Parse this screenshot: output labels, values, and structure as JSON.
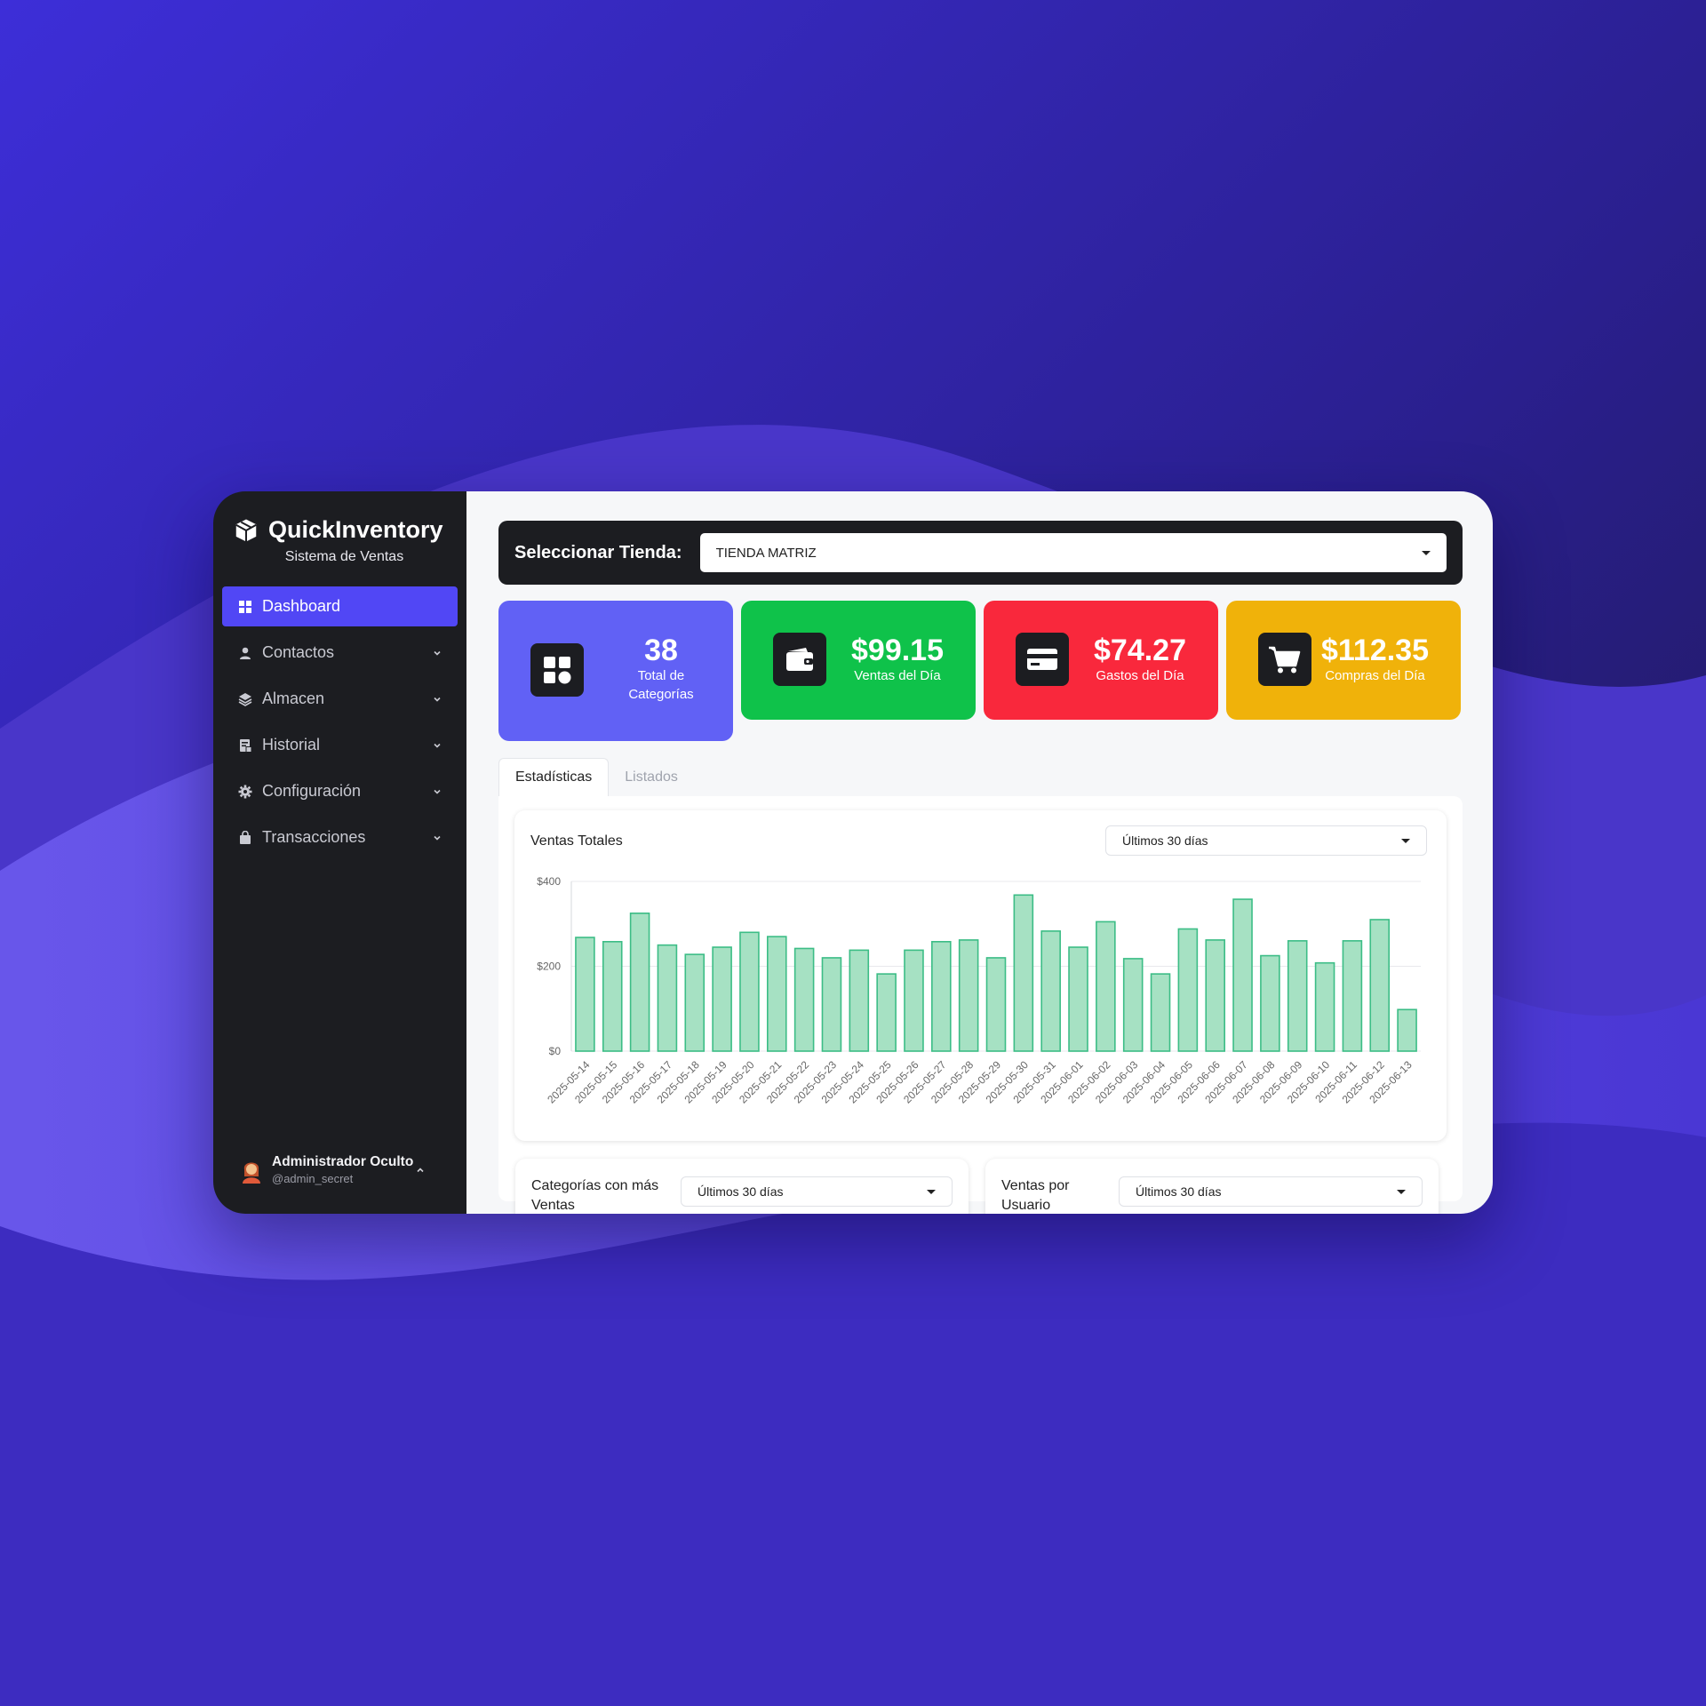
{
  "app": {
    "title": "QuickInventory",
    "subtitle": "Sistema de Ventas"
  },
  "sidebar": {
    "items": [
      {
        "label": "Dashboard",
        "icon": "grid-icon",
        "active": true
      },
      {
        "label": "Contactos",
        "icon": "user-icon"
      },
      {
        "label": "Almacen",
        "icon": "layers-icon"
      },
      {
        "label": "Historial",
        "icon": "receipt-icon"
      },
      {
        "label": "Configuración",
        "icon": "gear-icon"
      },
      {
        "label": "Transacciones",
        "icon": "bag-icon"
      }
    ]
  },
  "user": {
    "name": "Administrador Oculto",
    "handle": "@admin_secret"
  },
  "store": {
    "label": "Seleccionar Tienda:",
    "value": "TIENDA MATRIZ"
  },
  "cards": [
    {
      "value": "38",
      "label": "Total de Categorías",
      "color": "#6161f5",
      "icon": "categories-icon"
    },
    {
      "value": "$99.15",
      "label": "Ventas del Día",
      "color": "#0fc24a",
      "icon": "wallet-icon"
    },
    {
      "value": "$74.27",
      "label": "Gastos del Día",
      "color": "#f9283c",
      "icon": "credit-card-icon"
    },
    {
      "value": "$112.35",
      "label": "Compras del Día",
      "color": "#f0b20a",
      "icon": "cart-icon"
    }
  ],
  "tabs": [
    {
      "label": "Estadísticas",
      "active": true
    },
    {
      "label": "Listados"
    }
  ],
  "sales_chart": {
    "title": "Ventas Totales",
    "range": "Últimos 30 días"
  },
  "categories_card": {
    "title": "Categorías con más Ventas",
    "range": "Últimos 30 días"
  },
  "users_card": {
    "title": "Ventas por Usuario",
    "range": "Últimos 30 días"
  },
  "chart_data": {
    "type": "bar",
    "title": "Ventas Totales",
    "ylim": [
      0,
      400
    ],
    "y_ticks": [
      "$0",
      "$200",
      "$400"
    ],
    "grid": true,
    "bar_color": "#a6e1c3",
    "bar_stroke": "#3cbd86",
    "categories": [
      "2025-05-14",
      "2025-05-15",
      "2025-05-16",
      "2025-05-17",
      "2025-05-18",
      "2025-05-19",
      "2025-05-20",
      "2025-05-21",
      "2025-05-22",
      "2025-05-23",
      "2025-05-24",
      "2025-05-25",
      "2025-05-26",
      "2025-05-27",
      "2025-05-28",
      "2025-05-29",
      "2025-05-30",
      "2025-05-31",
      "2025-06-01",
      "2025-06-02",
      "2025-06-03",
      "2025-06-04",
      "2025-06-05",
      "2025-06-06",
      "2025-06-07",
      "2025-06-08",
      "2025-06-09",
      "2025-06-10",
      "2025-06-11",
      "2025-06-12",
      "2025-06-13"
    ],
    "values": [
      268,
      258,
      325,
      250,
      228,
      245,
      280,
      270,
      242,
      220,
      238,
      182,
      238,
      258,
      262,
      220,
      368,
      283,
      245,
      305,
      218,
      182,
      288,
      262,
      358,
      225,
      260,
      208,
      260,
      310,
      98
    ]
  }
}
